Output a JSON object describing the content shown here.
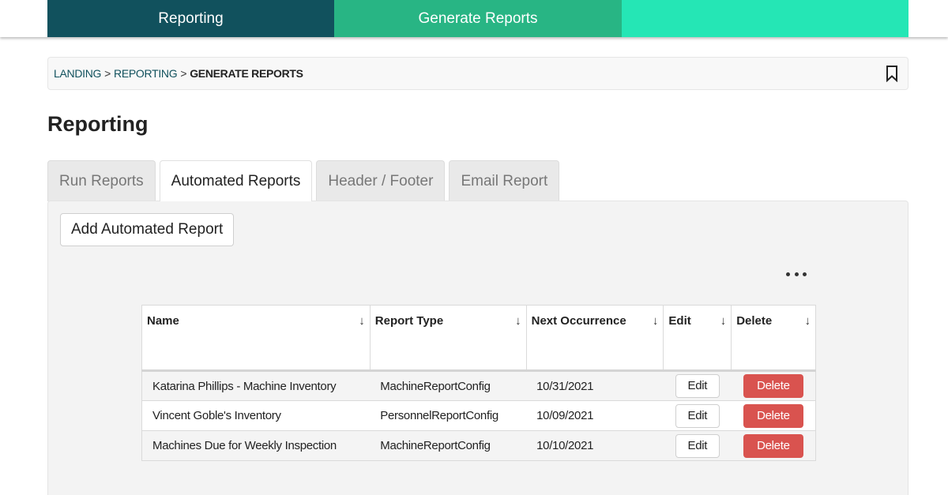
{
  "nav": {
    "items": [
      {
        "label": "Reporting"
      },
      {
        "label": "Generate Reports"
      },
      {
        "label": ""
      }
    ],
    "colors": {
      "primary": "#11515d",
      "secondary": "#28b584",
      "tertiary": "#25e6b5"
    }
  },
  "breadcrumb": {
    "items": [
      {
        "label": "LANDING"
      },
      {
        "label": "REPORTING"
      },
      {
        "label": "GENERATE REPORTS"
      }
    ],
    "separator": ">",
    "bookmark_icon": "bookmark-icon"
  },
  "page": {
    "title": "Reporting"
  },
  "tabs": [
    {
      "label": "Run Reports",
      "active": false
    },
    {
      "label": "Automated Reports",
      "active": true
    },
    {
      "label": "Header / Footer",
      "active": false
    },
    {
      "label": "Email Report",
      "active": false
    }
  ],
  "panel": {
    "add_button_label": "Add Automated Report",
    "more_icon": "more-horizontal-icon"
  },
  "table": {
    "columns": [
      {
        "label": "Name",
        "sort_arrow": "↓"
      },
      {
        "label": "Report Type",
        "sort_arrow": "↓"
      },
      {
        "label": "Next Occurrence",
        "sort_arrow": "↓"
      },
      {
        "label": "Edit",
        "sort_arrow": "↓"
      },
      {
        "label": "Delete",
        "sort_arrow": "↓"
      }
    ],
    "rows": [
      {
        "name": "Katarina Phillips - Machine Inventory",
        "report_type": "MachineReportConfig",
        "next_occurrence": "10/31/2021",
        "edit_label": "Edit",
        "delete_label": "Delete"
      },
      {
        "name": "Vincent Goble's Inventory",
        "report_type": "PersonnelReportConfig",
        "next_occurrence": "10/09/2021",
        "edit_label": "Edit",
        "delete_label": "Delete"
      },
      {
        "name": "Machines Due for Weekly Inspection",
        "report_type": "MachineReportConfig",
        "next_occurrence": "10/10/2021",
        "edit_label": "Edit",
        "delete_label": "Delete"
      }
    ],
    "delete_color": "#d9534f"
  }
}
